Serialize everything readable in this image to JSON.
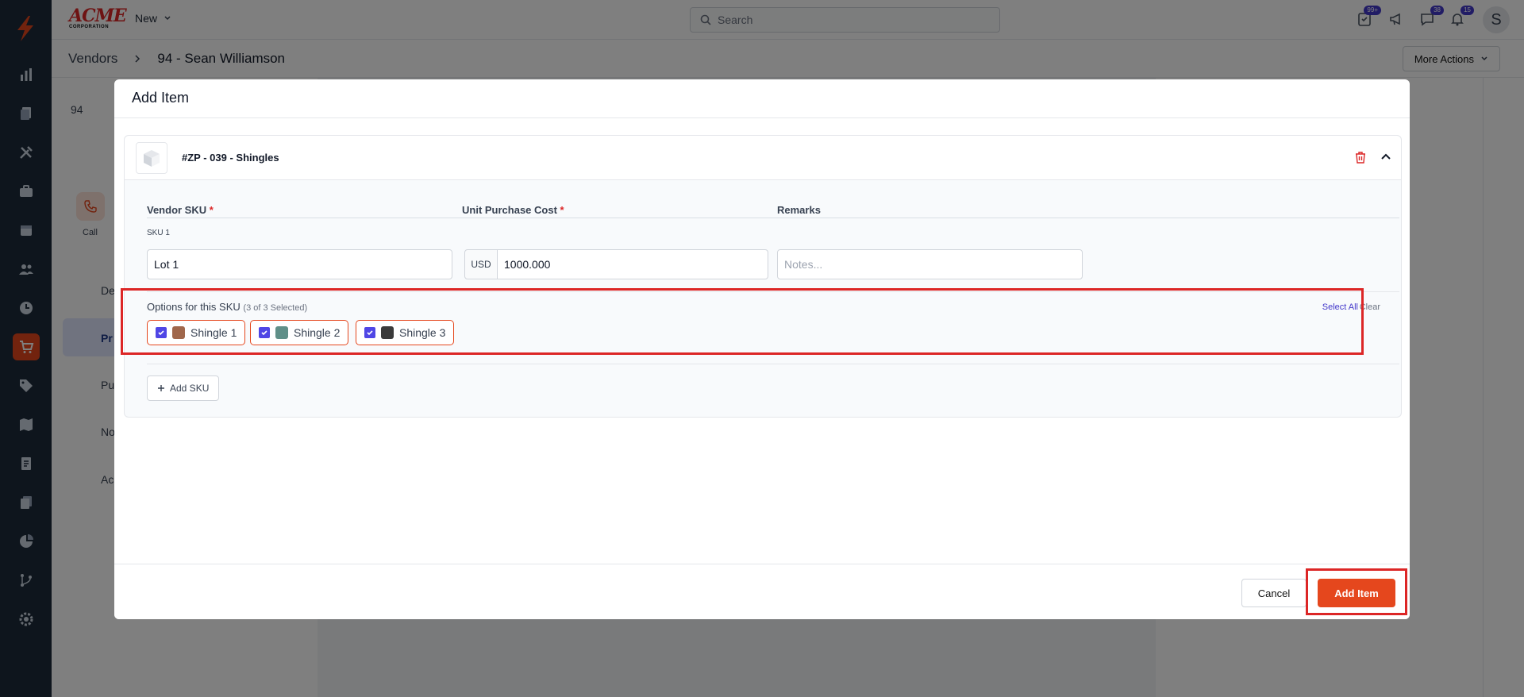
{
  "topbar": {
    "brand_top": "ACME",
    "brand_bottom": "CORPORATION",
    "new_label": "New",
    "search_placeholder": "Search",
    "badges": {
      "tasks": "99+",
      "messages": "38",
      "notifications": "15"
    },
    "avatar_initial": "S"
  },
  "breadcrumb": {
    "root": "Vendors",
    "current": "94 - Sean Williamson"
  },
  "more_actions": "More Actions",
  "background": {
    "id_text": "94",
    "call_label": "Call",
    "nav_items": [
      "De",
      "Pr",
      "Pu",
      "No",
      "Ac"
    ]
  },
  "modal": {
    "title": "Add Item",
    "item_title": "#ZP - 039 - Shingles",
    "fields": {
      "vendor_sku_label": "Vendor SKU",
      "unit_cost_label": "Unit Purchase Cost",
      "remarks_label": "Remarks",
      "required_mark": "*"
    },
    "sku_label": "SKU 1",
    "vendor_sku_value": "Lot 1",
    "currency": "USD",
    "unit_cost_value": "1000.000",
    "notes_placeholder": "Notes...",
    "options": {
      "title": "Options for this SKU",
      "count": "(3 of 3 Selected)",
      "select_all": "Select All",
      "clear": "Clear",
      "chips": [
        {
          "label": "Shingle 1",
          "checked": true,
          "swatch": "#a0674b"
        },
        {
          "label": "Shingle 2",
          "checked": true,
          "swatch": "#5f8f88"
        },
        {
          "label": "Shingle 3",
          "checked": true,
          "swatch": "#3a3a3a"
        }
      ]
    },
    "add_sku": "Add SKU",
    "cancel": "Cancel",
    "submit": "Add Item"
  },
  "colors": {
    "accent": "#e5471d",
    "sidebar": "#1c2b3a",
    "checkbox": "#4f46e5",
    "highlight": "#dc2626"
  }
}
